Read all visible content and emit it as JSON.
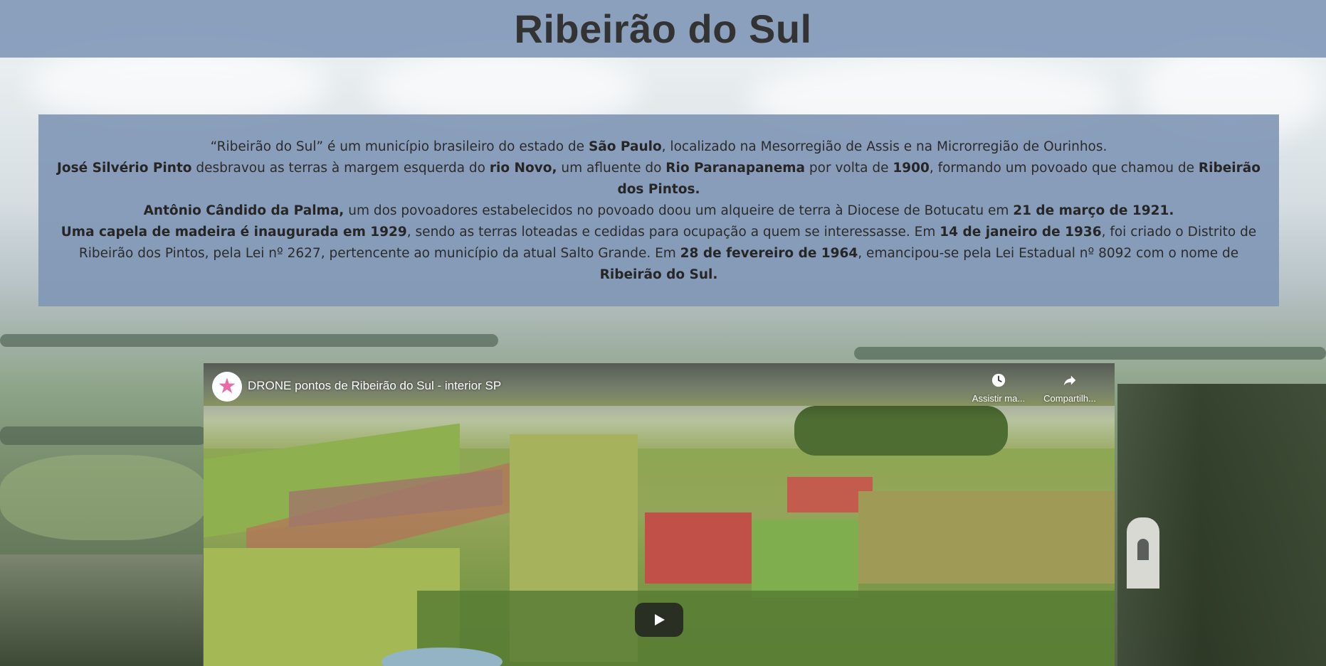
{
  "header": {
    "title": "Ribeirão do Sul"
  },
  "history": {
    "paragraphs": [
      [
        {
          "t": "“Ribeirão do Sul” é um município brasileiro do estado de ",
          "b": false
        },
        {
          "t": "São Paulo",
          "b": true
        },
        {
          "t": ", localizado na Mesorregião de Assis e na Microrregião de Ourinhos.",
          "b": false
        }
      ],
      [
        {
          "t": "José Silvério Pinto",
          "b": true
        },
        {
          "t": " desbravou as terras à margem esquerda do ",
          "b": false
        },
        {
          "t": "rio Novo,",
          "b": true
        },
        {
          "t": " um afluente do ",
          "b": false
        },
        {
          "t": "Rio Paranapanema",
          "b": true
        },
        {
          "t": " por volta de ",
          "b": false
        },
        {
          "t": "1900",
          "b": true
        },
        {
          "t": ", formando um povoado que chamou de ",
          "b": false
        },
        {
          "t": "Ribeirão dos Pintos.",
          "b": true
        }
      ],
      [
        {
          "t": "Antônio Cândido da Palma,",
          "b": true
        },
        {
          "t": " um dos povoadores estabelecidos no povoado doou um alqueire de terra à Diocese de Botucatu em ",
          "b": false
        },
        {
          "t": "21 de março de 1921.",
          "b": true
        }
      ],
      [
        {
          "t": "Uma capela de madeira é inaugurada em 1929",
          "b": true
        },
        {
          "t": ", sendo as terras loteadas e cedidas para ocupação a quem se interessasse. Em ",
          "b": false
        },
        {
          "t": "14 de janeiro de 1936",
          "b": true
        },
        {
          "t": ", foi criado o Distrito de Ribeirão dos Pintos, pela Lei nº 2627, pertencente ao município da atual Salto Grande. Em ",
          "b": false
        },
        {
          "t": "28 de fevereiro de 1964",
          "b": true
        },
        {
          "t": ", emancipou-se pela Lei Estadual nº 8092 com o nome de ",
          "b": false
        },
        {
          "t": "Ribeirão do Sul.",
          "b": true
        }
      ]
    ]
  },
  "video": {
    "title": "DRONE pontos de Ribeirão do Sul - interior SP",
    "watch_later_label": "Assistir ma...",
    "share_label": "Compartilh...",
    "channel_icon": "pink-star-icon",
    "play_icon": "play-icon"
  },
  "colors": {
    "header_bg": "#869cba",
    "panel_bg": "#8096b5",
    "title_text": "#333333",
    "play_button": "#212121"
  }
}
